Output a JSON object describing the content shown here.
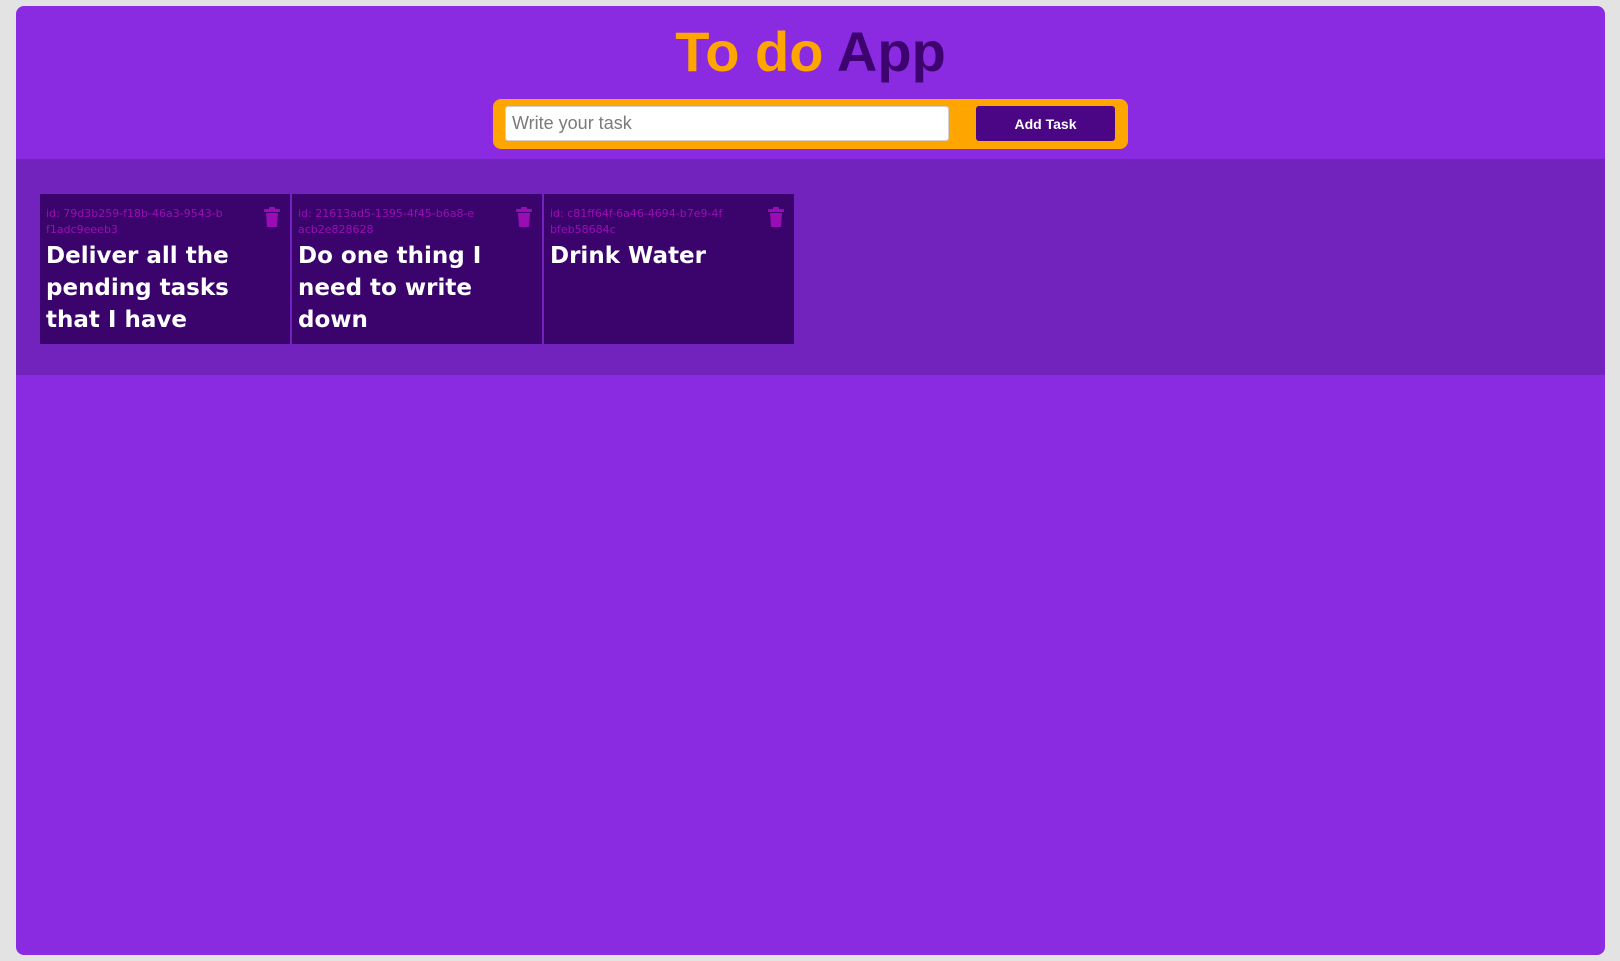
{
  "colors": {
    "page_background": "#e3e3e3",
    "app_background": "#8a2be2",
    "title_accent": "#ffa500",
    "title_dark": "#3d0470",
    "form_background": "#ffa500",
    "button_background": "#4a0685",
    "tasks_area_background": "#7222bd",
    "task_card_background": "#3b046c",
    "task_id_color": "#9b0db4",
    "trash_icon_color": "#9b0db4"
  },
  "header": {
    "title_part1": "To do",
    "title_part2": "App"
  },
  "form": {
    "input_placeholder": "Write your task",
    "input_value": "",
    "add_button_label": "Add Task"
  },
  "tasks": [
    {
      "id_text": "id: 79d3b259-f18b-46a3-9543-bf1adc9eeeb3",
      "text": "Deliver all the pending tasks that I have",
      "icon": "trash-icon"
    },
    {
      "id_text": "id: 21613ad5-1395-4f45-b6a8-eacb2e828628",
      "text": "Do one thing I need to write down",
      "icon": "trash-icon"
    },
    {
      "id_text": "id: c81ff64f-6a46-4694-b7e9-4fbfeb58684c",
      "text": "Drink Water",
      "icon": "trash-icon"
    }
  ]
}
